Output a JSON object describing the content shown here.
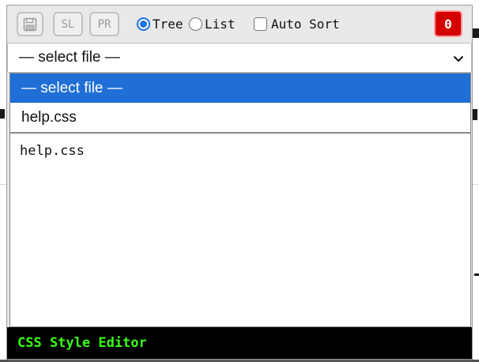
{
  "toolbar": {
    "save_icon": "floppy-disk-icon",
    "sl_label": "SL",
    "pr_label": "PR",
    "view_options": [
      {
        "label": "Tree",
        "checked": true
      },
      {
        "label": "List",
        "checked": false
      }
    ],
    "auto_sort_label": "Auto Sort",
    "auto_sort_checked": false,
    "error_count": "0",
    "error_color": "#d40000"
  },
  "file_select": {
    "selected": "— select file —",
    "options": [
      "— select file —",
      "help.css"
    ]
  },
  "file_list": {
    "items": [
      "help.css"
    ]
  },
  "status_bar": {
    "text": "CSS Style Editor",
    "text_color": "#39ff14"
  },
  "colors": {
    "accent": "#1f6fd6",
    "panel_bg": "#e9e9e9"
  }
}
